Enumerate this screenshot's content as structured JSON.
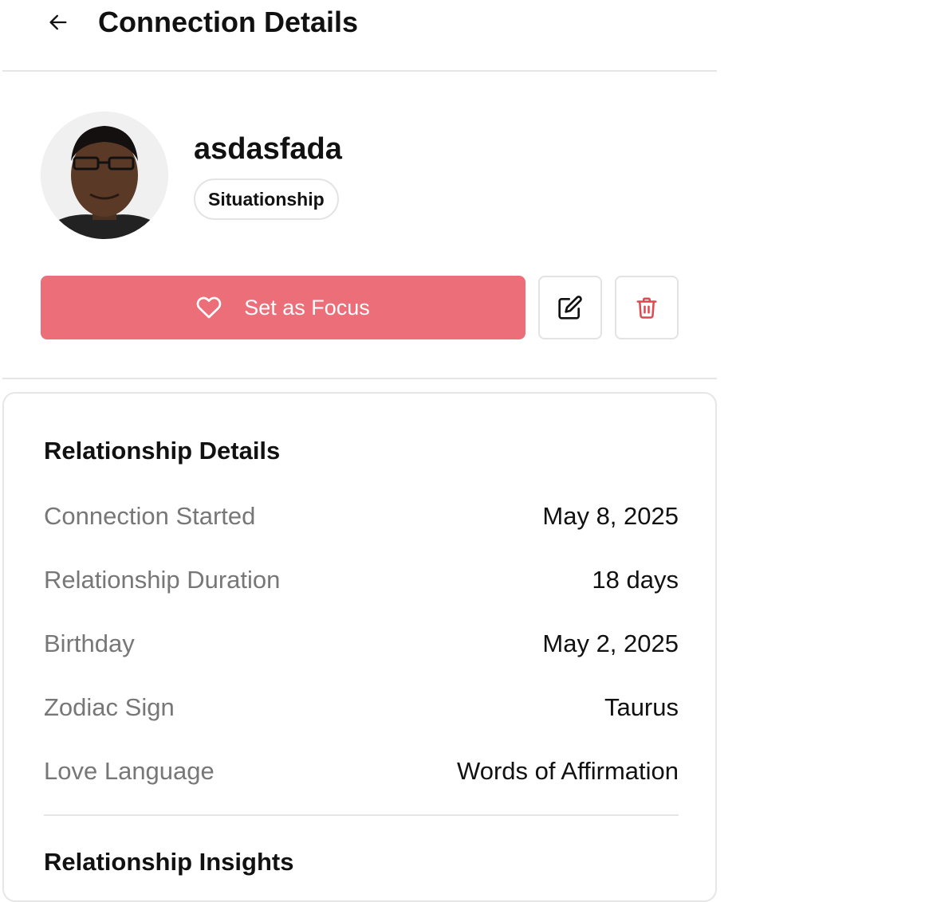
{
  "header": {
    "back_icon": "arrow-left-icon",
    "title": "Connection Details"
  },
  "profile": {
    "name": "asdasfada",
    "tag": "Situationship",
    "avatar": "avatar-photo"
  },
  "actions": {
    "focus_label": "Set as Focus",
    "focus_icon": "heart-icon",
    "edit_icon": "edit-icon",
    "delete_icon": "trash-icon"
  },
  "details": {
    "title": "Relationship Details",
    "rows": [
      {
        "label": "Connection Started",
        "value": "May 8, 2025"
      },
      {
        "label": "Relationship Duration",
        "value": "18 days"
      },
      {
        "label": "Birthday",
        "value": "May 2, 2025"
      },
      {
        "label": "Zodiac Sign",
        "value": "Taurus"
      },
      {
        "label": "Love Language",
        "value": "Words of Affirmation"
      }
    ]
  },
  "insights": {
    "title": "Relationship Insights"
  },
  "colors": {
    "accent": "#ec6e79",
    "delete": "#e0474e",
    "muted_text": "#777777",
    "border": "#e6e6e6"
  }
}
